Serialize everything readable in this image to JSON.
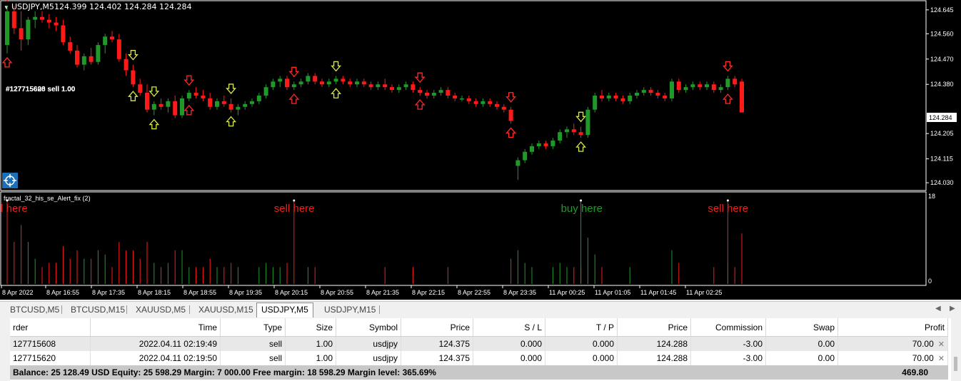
{
  "chart": {
    "header": "USDJPY,M5  124.399 124.402 124.284 124.284",
    "header_symbol": "USDJPY,M5",
    "header_ohlc": "124.399 124.402 124.284 124.284",
    "trade_label": "#127715608 sell 1.00",
    "trade_label_2": "#127715620 sell 1.00",
    "current_price": "124.284",
    "price_axis": [
      "124.645",
      "124.560",
      "124.470",
      "124.380",
      "124.284",
      "124.205",
      "124.115",
      "124.030"
    ],
    "price_range": [
      124.01,
      124.67
    ],
    "candles": [
      {
        "o": 124.52,
        "h": 124.66,
        "l": 124.49,
        "c": 124.64
      },
      {
        "o": 124.64,
        "h": 124.66,
        "l": 124.56,
        "c": 124.58
      },
      {
        "o": 124.58,
        "h": 124.64,
        "l": 124.5,
        "c": 124.54
      },
      {
        "o": 124.54,
        "h": 124.62,
        "l": 124.52,
        "c": 124.61
      },
      {
        "o": 124.61,
        "h": 124.64,
        "l": 124.58,
        "c": 124.62
      },
      {
        "o": 124.62,
        "h": 124.64,
        "l": 124.6,
        "c": 124.61
      },
      {
        "o": 124.61,
        "h": 124.63,
        "l": 124.58,
        "c": 124.6
      },
      {
        "o": 124.6,
        "h": 124.62,
        "l": 124.57,
        "c": 124.59
      },
      {
        "o": 124.59,
        "h": 124.61,
        "l": 124.52,
        "c": 124.53
      },
      {
        "o": 124.53,
        "h": 124.55,
        "l": 124.49,
        "c": 124.5
      },
      {
        "o": 124.5,
        "h": 124.52,
        "l": 124.44,
        "c": 124.45
      },
      {
        "o": 124.45,
        "h": 124.49,
        "l": 124.43,
        "c": 124.48
      },
      {
        "o": 124.48,
        "h": 124.51,
        "l": 124.45,
        "c": 124.46
      },
      {
        "o": 124.46,
        "h": 124.53,
        "l": 124.45,
        "c": 124.52
      },
      {
        "o": 124.52,
        "h": 124.56,
        "l": 124.49,
        "c": 124.55
      },
      {
        "o": 124.55,
        "h": 124.57,
        "l": 124.53,
        "c": 124.54
      },
      {
        "o": 124.54,
        "h": 124.56,
        "l": 124.46,
        "c": 124.47
      },
      {
        "o": 124.47,
        "h": 124.49,
        "l": 124.41,
        "c": 124.43
      },
      {
        "o": 124.43,
        "h": 124.45,
        "l": 124.37,
        "c": 124.38
      },
      {
        "o": 124.38,
        "h": 124.4,
        "l": 124.34,
        "c": 124.35
      },
      {
        "o": 124.35,
        "h": 124.38,
        "l": 124.28,
        "c": 124.29
      },
      {
        "o": 124.29,
        "h": 124.32,
        "l": 124.27,
        "c": 124.31
      },
      {
        "o": 124.31,
        "h": 124.33,
        "l": 124.29,
        "c": 124.3
      },
      {
        "o": 124.3,
        "h": 124.33,
        "l": 124.28,
        "c": 124.32
      },
      {
        "o": 124.32,
        "h": 124.34,
        "l": 124.26,
        "c": 124.27
      },
      {
        "o": 124.27,
        "h": 124.34,
        "l": 124.26,
        "c": 124.33
      },
      {
        "o": 124.33,
        "h": 124.36,
        "l": 124.32,
        "c": 124.35
      },
      {
        "o": 124.35,
        "h": 124.37,
        "l": 124.33,
        "c": 124.34
      },
      {
        "o": 124.34,
        "h": 124.36,
        "l": 124.32,
        "c": 124.33
      },
      {
        "o": 124.33,
        "h": 124.35,
        "l": 124.29,
        "c": 124.3
      },
      {
        "o": 124.3,
        "h": 124.33,
        "l": 124.29,
        "c": 124.32
      },
      {
        "o": 124.32,
        "h": 124.34,
        "l": 124.3,
        "c": 124.31
      },
      {
        "o": 124.31,
        "h": 124.33,
        "l": 124.28,
        "c": 124.29
      },
      {
        "o": 124.29,
        "h": 124.31,
        "l": 124.27,
        "c": 124.3
      },
      {
        "o": 124.3,
        "h": 124.32,
        "l": 124.29,
        "c": 124.31
      },
      {
        "o": 124.31,
        "h": 124.33,
        "l": 124.3,
        "c": 124.32
      },
      {
        "o": 124.32,
        "h": 124.35,
        "l": 124.31,
        "c": 124.34
      },
      {
        "o": 124.34,
        "h": 124.38,
        "l": 124.33,
        "c": 124.37
      },
      {
        "o": 124.37,
        "h": 124.4,
        "l": 124.36,
        "c": 124.39
      },
      {
        "o": 124.39,
        "h": 124.41,
        "l": 124.37,
        "c": 124.4
      },
      {
        "o": 124.4,
        "h": 124.41,
        "l": 124.36,
        "c": 124.37
      },
      {
        "o": 124.37,
        "h": 124.39,
        "l": 124.36,
        "c": 124.38
      },
      {
        "o": 124.38,
        "h": 124.4,
        "l": 124.37,
        "c": 124.39
      },
      {
        "o": 124.39,
        "h": 124.42,
        "l": 124.38,
        "c": 124.41
      },
      {
        "o": 124.41,
        "h": 124.42,
        "l": 124.38,
        "c": 124.39
      },
      {
        "o": 124.39,
        "h": 124.4,
        "l": 124.37,
        "c": 124.38
      },
      {
        "o": 124.38,
        "h": 124.4,
        "l": 124.37,
        "c": 124.39
      },
      {
        "o": 124.39,
        "h": 124.41,
        "l": 124.38,
        "c": 124.4
      },
      {
        "o": 124.4,
        "h": 124.41,
        "l": 124.38,
        "c": 124.39
      },
      {
        "o": 124.39,
        "h": 124.4,
        "l": 124.37,
        "c": 124.38
      },
      {
        "o": 124.38,
        "h": 124.4,
        "l": 124.37,
        "c": 124.39
      },
      {
        "o": 124.39,
        "h": 124.4,
        "l": 124.37,
        "c": 124.38
      },
      {
        "o": 124.38,
        "h": 124.39,
        "l": 124.36,
        "c": 124.37
      },
      {
        "o": 124.37,
        "h": 124.39,
        "l": 124.36,
        "c": 124.38
      },
      {
        "o": 124.38,
        "h": 124.4,
        "l": 124.36,
        "c": 124.37
      },
      {
        "o": 124.37,
        "h": 124.38,
        "l": 124.35,
        "c": 124.36
      },
      {
        "o": 124.36,
        "h": 124.38,
        "l": 124.35,
        "c": 124.37
      },
      {
        "o": 124.37,
        "h": 124.39,
        "l": 124.36,
        "c": 124.38
      },
      {
        "o": 124.38,
        "h": 124.39,
        "l": 124.35,
        "c": 124.36
      },
      {
        "o": 124.36,
        "h": 124.37,
        "l": 124.34,
        "c": 124.35
      },
      {
        "o": 124.35,
        "h": 124.36,
        "l": 124.33,
        "c": 124.34
      },
      {
        "o": 124.34,
        "h": 124.36,
        "l": 124.33,
        "c": 124.35
      },
      {
        "o": 124.35,
        "h": 124.37,
        "l": 124.34,
        "c": 124.36
      },
      {
        "o": 124.36,
        "h": 124.37,
        "l": 124.33,
        "c": 124.34
      },
      {
        "o": 124.34,
        "h": 124.35,
        "l": 124.32,
        "c": 124.33
      },
      {
        "o": 124.33,
        "h": 124.34,
        "l": 124.32,
        "c": 124.33
      },
      {
        "o": 124.33,
        "h": 124.34,
        "l": 124.31,
        "c": 124.32
      },
      {
        "o": 124.32,
        "h": 124.33,
        "l": 124.3,
        "c": 124.31
      },
      {
        "o": 124.31,
        "h": 124.33,
        "l": 124.3,
        "c": 124.32
      },
      {
        "o": 124.32,
        "h": 124.33,
        "l": 124.3,
        "c": 124.31
      },
      {
        "o": 124.31,
        "h": 124.32,
        "l": 124.29,
        "c": 124.3
      },
      {
        "o": 124.3,
        "h": 124.31,
        "l": 124.28,
        "c": 124.29
      },
      {
        "o": 124.29,
        "h": 124.3,
        "l": 124.24,
        "c": 124.25
      },
      {
        "o": 124.09,
        "h": 124.12,
        "l": 124.04,
        "c": 124.11
      },
      {
        "o": 124.11,
        "h": 124.15,
        "l": 124.1,
        "c": 124.14
      },
      {
        "o": 124.14,
        "h": 124.17,
        "l": 124.13,
        "c": 124.16
      },
      {
        "o": 124.16,
        "h": 124.18,
        "l": 124.15,
        "c": 124.17
      },
      {
        "o": 124.17,
        "h": 124.18,
        "l": 124.15,
        "c": 124.16
      },
      {
        "o": 124.16,
        "h": 124.19,
        "l": 124.15,
        "c": 124.18
      },
      {
        "o": 124.18,
        "h": 124.22,
        "l": 124.17,
        "c": 124.21
      },
      {
        "o": 124.21,
        "h": 124.23,
        "l": 124.19,
        "c": 124.22
      },
      {
        "o": 124.22,
        "h": 124.24,
        "l": 124.2,
        "c": 124.21
      },
      {
        "o": 124.21,
        "h": 124.23,
        "l": 124.19,
        "c": 124.2
      },
      {
        "o": 124.2,
        "h": 124.3,
        "l": 124.19,
        "c": 124.29
      },
      {
        "o": 124.29,
        "h": 124.35,
        "l": 124.28,
        "c": 124.34
      },
      {
        "o": 124.34,
        "h": 124.36,
        "l": 124.32,
        "c": 124.33
      },
      {
        "o": 124.33,
        "h": 124.35,
        "l": 124.32,
        "c": 124.34
      },
      {
        "o": 124.34,
        "h": 124.35,
        "l": 124.32,
        "c": 124.33
      },
      {
        "o": 124.33,
        "h": 124.34,
        "l": 124.31,
        "c": 124.32
      },
      {
        "o": 124.32,
        "h": 124.35,
        "l": 124.31,
        "c": 124.34
      },
      {
        "o": 124.34,
        "h": 124.36,
        "l": 124.33,
        "c": 124.35
      },
      {
        "o": 124.35,
        "h": 124.37,
        "l": 124.34,
        "c": 124.36
      },
      {
        "o": 124.36,
        "h": 124.37,
        "l": 124.34,
        "c": 124.35
      },
      {
        "o": 124.35,
        "h": 124.36,
        "l": 124.33,
        "c": 124.34
      },
      {
        "o": 124.34,
        "h": 124.35,
        "l": 124.32,
        "c": 124.33
      },
      {
        "o": 124.33,
        "h": 124.4,
        "l": 124.32,
        "c": 124.39
      },
      {
        "o": 124.39,
        "h": 124.4,
        "l": 124.35,
        "c": 124.36
      },
      {
        "o": 124.36,
        "h": 124.38,
        "l": 124.35,
        "c": 124.37
      },
      {
        "o": 124.37,
        "h": 124.39,
        "l": 124.36,
        "c": 124.38
      },
      {
        "o": 124.38,
        "h": 124.39,
        "l": 124.36,
        "c": 124.37
      },
      {
        "o": 124.37,
        "h": 124.39,
        "l": 124.36,
        "c": 124.38
      },
      {
        "o": 124.38,
        "h": 124.39,
        "l": 124.35,
        "c": 124.36
      },
      {
        "o": 124.36,
        "h": 124.38,
        "l": 124.35,
        "c": 124.37
      },
      {
        "o": 124.37,
        "h": 124.41,
        "l": 124.36,
        "c": 124.4
      },
      {
        "o": 124.4,
        "h": 124.41,
        "l": 124.37,
        "c": 124.38
      },
      {
        "o": 124.39,
        "h": 124.4,
        "l": 124.28,
        "c": 124.28
      }
    ],
    "arrows": [
      {
        "i": 0,
        "kind": "sell",
        "pos": "above"
      },
      {
        "i": 0,
        "kind": "sell",
        "pos": "below"
      },
      {
        "i": 18,
        "kind": "buy",
        "pos": "above"
      },
      {
        "i": 18,
        "kind": "buy",
        "pos": "below"
      },
      {
        "i": 21,
        "kind": "buy",
        "pos": "above"
      },
      {
        "i": 21,
        "kind": "buy",
        "pos": "below"
      },
      {
        "i": 26,
        "kind": "sell",
        "pos": "above"
      },
      {
        "i": 26,
        "kind": "sell",
        "pos": "below"
      },
      {
        "i": 32,
        "kind": "buy",
        "pos": "above"
      },
      {
        "i": 32,
        "kind": "buy",
        "pos": "below"
      },
      {
        "i": 41,
        "kind": "sell",
        "pos": "above"
      },
      {
        "i": 41,
        "kind": "sell",
        "pos": "below"
      },
      {
        "i": 47,
        "kind": "buy",
        "pos": "above"
      },
      {
        "i": 47,
        "kind": "buy",
        "pos": "below"
      },
      {
        "i": 59,
        "kind": "sell",
        "pos": "above"
      },
      {
        "i": 59,
        "kind": "sell",
        "pos": "below"
      },
      {
        "i": 72,
        "kind": "sell",
        "pos": "above"
      },
      {
        "i": 72,
        "kind": "sell",
        "pos": "below"
      },
      {
        "i": 82,
        "kind": "buy",
        "pos": "above"
      },
      {
        "i": 82,
        "kind": "buy",
        "pos": "below"
      },
      {
        "i": 103,
        "kind": "sell",
        "pos": "above"
      },
      {
        "i": 103,
        "kind": "sell",
        "pos": "below"
      }
    ],
    "colors": {
      "bull": "#1f9a2a",
      "bear": "#ff1a1a",
      "buy_arrow": "#d8e84a",
      "sell_arrow": "#ff2a2a",
      "grid": "#ffffff"
    }
  },
  "indicator": {
    "title": "fractal_32_his_se_Alert_fix (2)",
    "axis_top": "18",
    "axis_bottom": "0",
    "labels": [
      {
        "text": "sell here",
        "color": "#e8211d",
        "bar": 0
      },
      {
        "text": "sell here",
        "color": "#e8211d",
        "bar": 41
      },
      {
        "text": "buy here",
        "color": "#1f9a2a",
        "bar": 82
      },
      {
        "text": "sell here",
        "color": "#e8211d",
        "bar": 103
      }
    ]
  },
  "time_axis": [
    "8 Apr 2022",
    "8 Apr 16:55",
    "8 Apr 17:35",
    "8 Apr 18:15",
    "8 Apr 18:55",
    "8 Apr 19:35",
    "8 Apr 20:15",
    "8 Apr 20:55",
    "8 Apr 21:35",
    "8 Apr 22:15",
    "8 Apr 22:55",
    "8 Apr 23:35",
    "11 Apr 00:25",
    "11 Apr 01:05",
    "11 Apr 01:45",
    "11 Apr 02:25"
  ],
  "tabs": [
    "BTCUSD,M5",
    "BTCUSD,M15",
    "XAUUSD,M5",
    "XAUUSD,M15",
    "USDJPY,M5",
    "USDJPY,M15"
  ],
  "active_tab": "USDJPY,M5",
  "trades": {
    "headers": [
      "rder",
      "Time",
      "Type",
      "Size",
      "Symbol",
      "Price",
      "S / L",
      "T / P",
      "Price",
      "Commission",
      "Swap",
      "Profit"
    ],
    "rows": [
      [
        "127715608",
        "2022.04.11 02:19:49",
        "sell",
        "1.00",
        "usdjpy",
        "124.375",
        "0.000",
        "0.000",
        "124.288",
        "-3.00",
        "0.00",
        "70.00"
      ],
      [
        "127715620",
        "2022.04.11 02:19:50",
        "sell",
        "1.00",
        "usdjpy",
        "124.375",
        "0.000",
        "0.000",
        "124.288",
        "-3.00",
        "0.00",
        "70.00"
      ]
    ]
  },
  "balance": {
    "text": "Balance: 25 128.49 USD  Equity: 25 598.29  Margin: 7 000.00  Free margin: 18 598.29  Margin level: 365.69%",
    "total": "469.80"
  }
}
